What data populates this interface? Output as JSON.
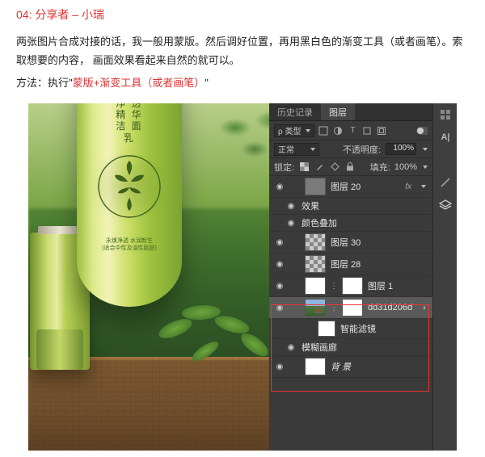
{
  "heading": "04: 分享者 – 小瑞",
  "para1": "两张图片合成对接的话，我一般用蒙版。然后调好位置，再用黑白色的渐变工具（或者画笔）。索取想要的内容， 画面效果看起来自然的就可以。",
  "method_prefix": "方法：执行\"",
  "method_hl": "蒙版+渐变工具（或者画笔）",
  "method_suffix": "\"",
  "product": {
    "name_lines": "永 焕\n净 透\n精 华\n洁 面\n乳",
    "fine1": "永焕净透 水润新生",
    "fine2": "(适合中性及油性肌肤)"
  },
  "ps": {
    "tab_history": "历史记录",
    "tab_layers": "图层",
    "filter_kind": "ρ 类型",
    "mode": "正常",
    "opacity_label": "不透明度:",
    "opacity_value": "100%",
    "lock_label": "锁定:",
    "fill_label": "填充:",
    "fill_value": "100%",
    "layers": {
      "l20": "图层 20",
      "fx": "fx",
      "effects": "效果",
      "coloroverlay": "颜色叠加",
      "l30": "图层 30",
      "l28": "图层 28",
      "l1": "图层 1",
      "smart": "dd31d206d",
      "smartfilters": "智能滤镜",
      "blur": "模糊画廊",
      "bg": "背 景"
    }
  }
}
